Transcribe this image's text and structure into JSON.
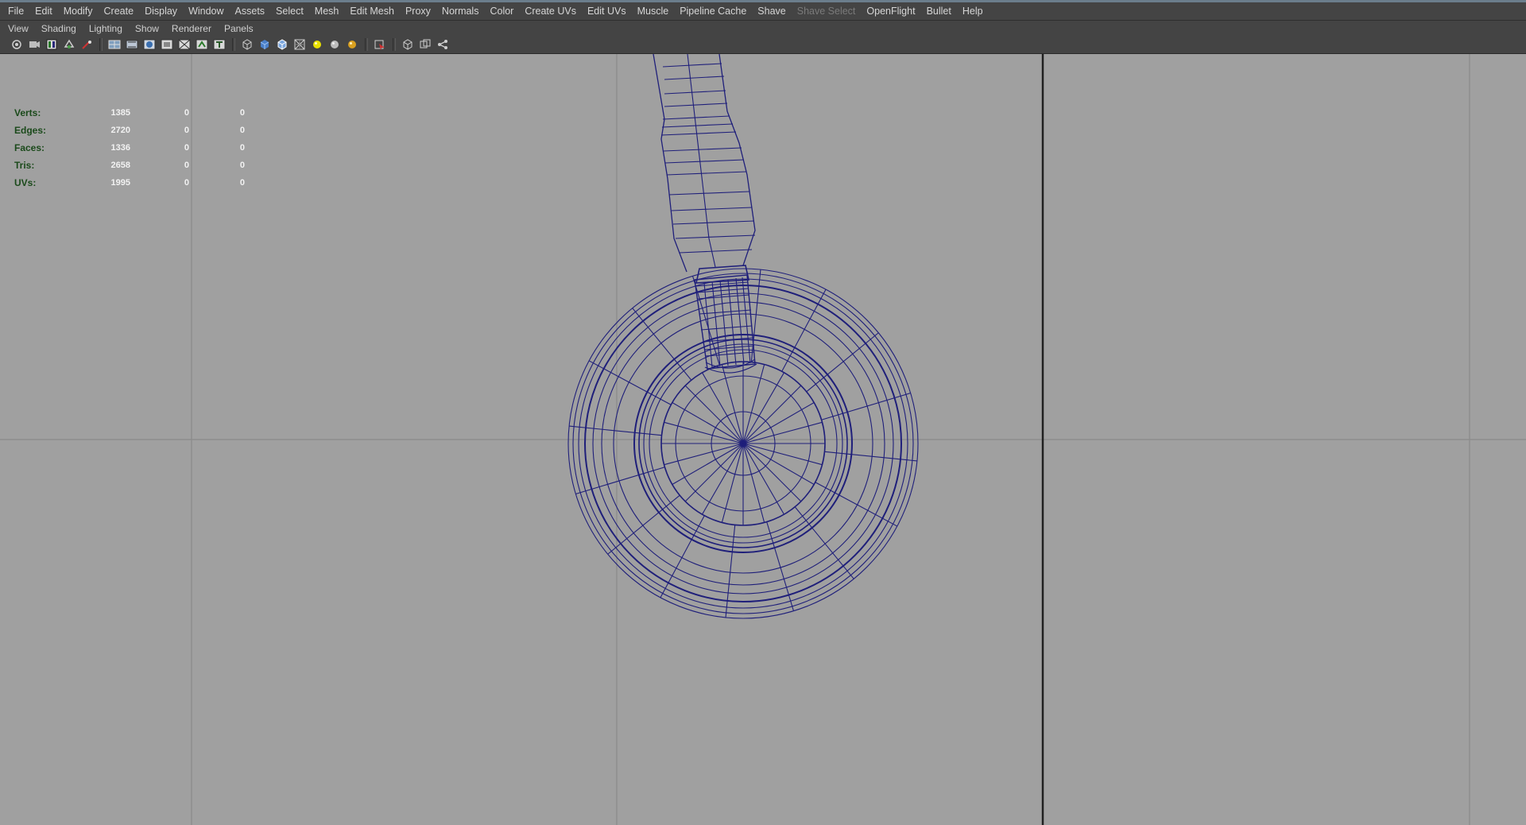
{
  "main_menu": {
    "items": [
      "File",
      "Edit",
      "Modify",
      "Create",
      "Display",
      "Window",
      "Assets",
      "Select",
      "Mesh",
      "Edit Mesh",
      "Proxy",
      "Normals",
      "Color",
      "Create UVs",
      "Edit UVs",
      "Muscle",
      "Pipeline Cache",
      "Shave",
      "Shave Select",
      "OpenFlight",
      "Bullet",
      "Help"
    ],
    "disabled_item": "Shave Select"
  },
  "panel_menu": {
    "items": [
      "View",
      "Shading",
      "Lighting",
      "Show",
      "Renderer",
      "Panels"
    ]
  },
  "toolbar": {
    "icons": [
      "camera-attributes-icon",
      "bookmark-icon",
      "image-plane-icon",
      "2d-pan-zoom-icon",
      "grease-pencil-icon",
      "grid-icon",
      "film-gate-icon",
      "resolution-gate-icon",
      "gate-mask-icon",
      "field-chart-icon",
      "safe-action-icon",
      "safe-title-icon",
      "wireframe-icon",
      "smooth-shade-icon",
      "wireframe-on-shaded-icon",
      "xray-icon",
      "default-light-icon",
      "shadows-icon",
      "ambient-occlusion-icon",
      "isolate-select-icon",
      "frame-all-icon",
      "frame-selected-icon",
      "share-icon"
    ]
  },
  "poly_count": {
    "rows": [
      {
        "label": "Verts:",
        "v1": "1385",
        "v2": "0",
        "v3": "0"
      },
      {
        "label": "Edges:",
        "v1": "2720",
        "v2": "0",
        "v3": "0"
      },
      {
        "label": "Faces:",
        "v1": "1336",
        "v2": "0",
        "v3": "0"
      },
      {
        "label": "Tris:",
        "v1": "2658",
        "v2": "0",
        "v3": "0"
      },
      {
        "label": "UVs:",
        "v1": "1995",
        "v2": "0",
        "v3": "0"
      }
    ]
  },
  "colors": {
    "menu_bg": "#444444",
    "viewport_bg": "#a0a0a0",
    "wireframe": "#1f1f7a",
    "hud_label": "#1b4a1b",
    "hud_value": "#f2f2f2"
  }
}
